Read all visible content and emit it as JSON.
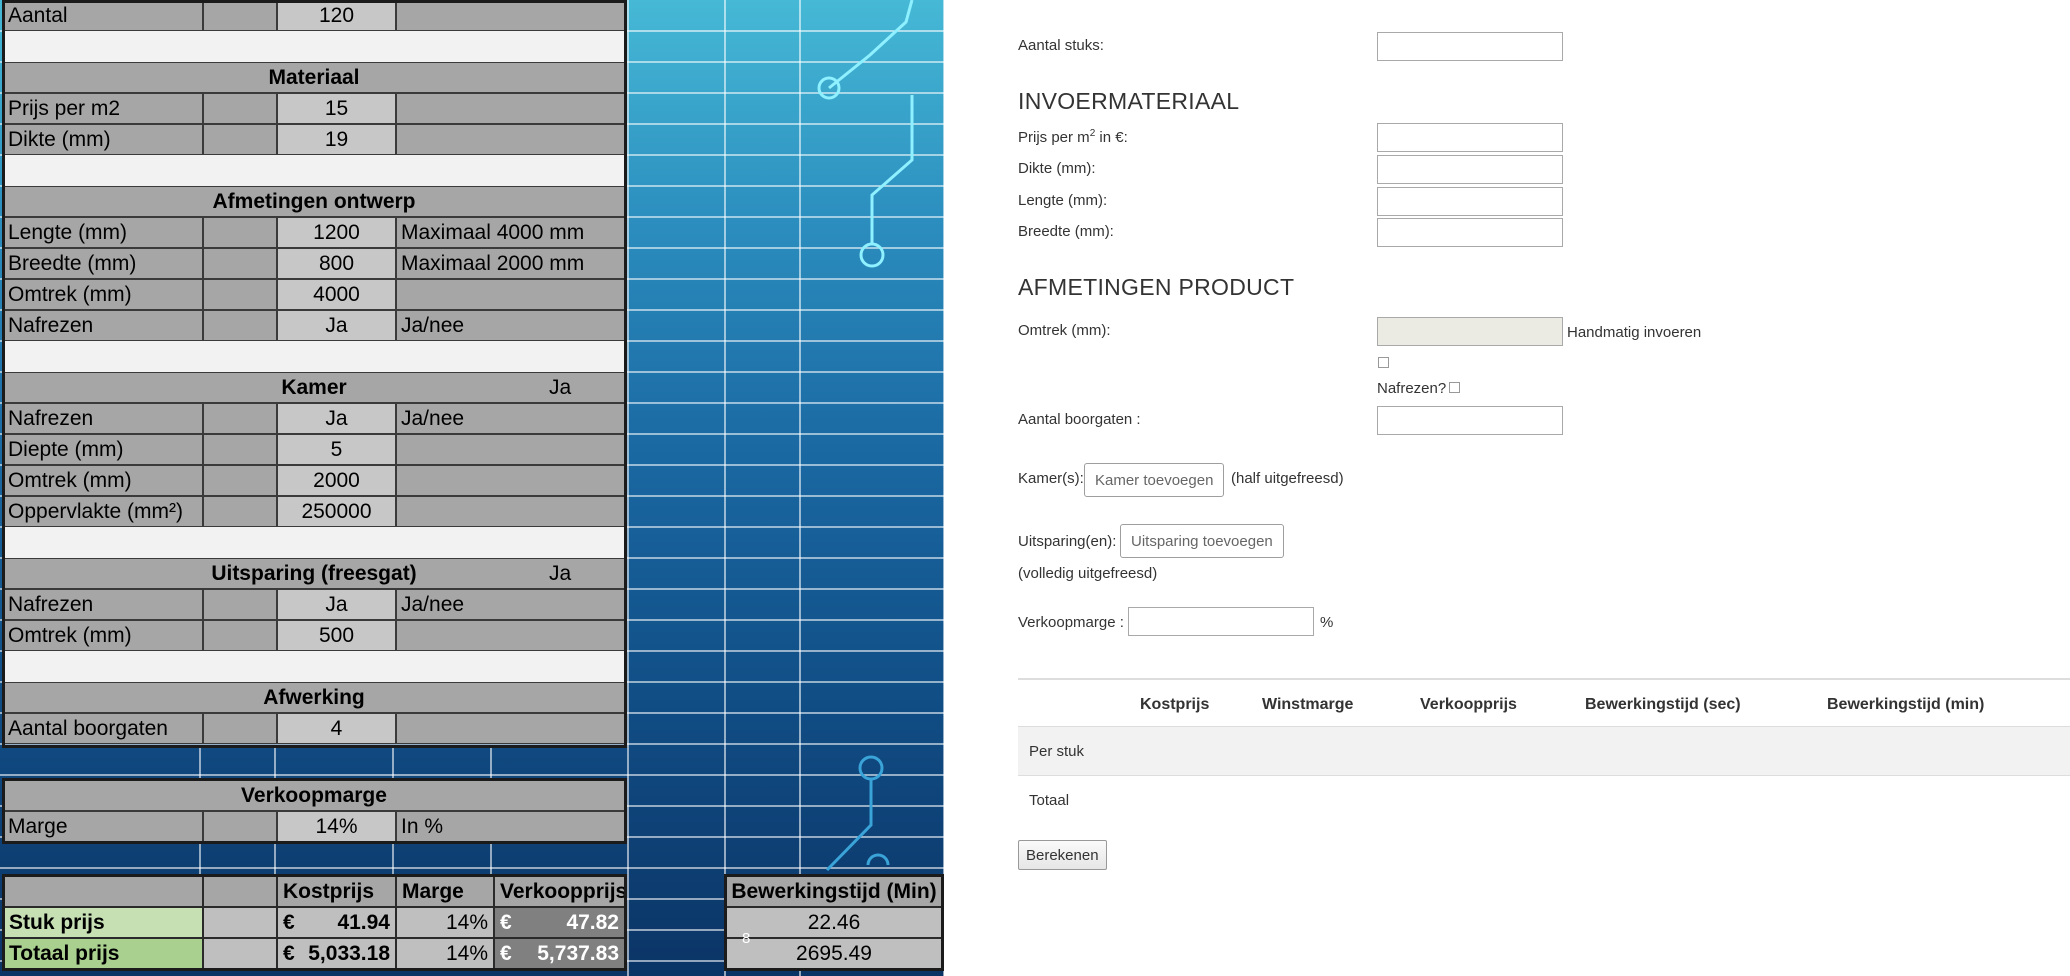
{
  "sheet": {
    "rows": [
      {
        "kind": "data",
        "label": "Aantal",
        "value": "120",
        "note": ""
      },
      {
        "kind": "band"
      },
      {
        "kind": "head",
        "title": "Materiaal",
        "flag": ""
      },
      {
        "kind": "data",
        "label": "Prijs per m2",
        "value": "15",
        "note": ""
      },
      {
        "kind": "data",
        "label": "Dikte (mm)",
        "value": "19",
        "note": ""
      },
      {
        "kind": "band"
      },
      {
        "kind": "head",
        "title": "Afmetingen ontwerp",
        "flag": ""
      },
      {
        "kind": "data",
        "label": "Lengte (mm)",
        "value": "1200",
        "note": "Maximaal 4000 mm"
      },
      {
        "kind": "data",
        "label": "Breedte (mm)",
        "value": "800",
        "note": "Maximaal 2000 mm"
      },
      {
        "kind": "data",
        "label": "Omtrek (mm)",
        "value": "4000",
        "note": ""
      },
      {
        "kind": "data",
        "label": "Nafrezen",
        "value": "Ja",
        "note": "Ja/nee"
      },
      {
        "kind": "band"
      },
      {
        "kind": "head",
        "title": "Kamer",
        "flag": "Ja"
      },
      {
        "kind": "data",
        "label": "Nafrezen",
        "value": "Ja",
        "note": "Ja/nee"
      },
      {
        "kind": "data",
        "label": "Diepte (mm)",
        "value": "5",
        "note": ""
      },
      {
        "kind": "data",
        "label": "Omtrek (mm)",
        "value": "2000",
        "note": ""
      },
      {
        "kind": "data",
        "label": "Oppervlakte (mm²)",
        "value": "250000",
        "note": ""
      },
      {
        "kind": "band"
      },
      {
        "kind": "head",
        "title": "Uitsparing (freesgat)",
        "flag": "Ja"
      },
      {
        "kind": "data",
        "label": "Nafrezen",
        "value": "Ja",
        "note": "Ja/nee"
      },
      {
        "kind": "data",
        "label": "Omtrek (mm)",
        "value": "500",
        "note": ""
      },
      {
        "kind": "band"
      },
      {
        "kind": "head",
        "title": "Afwerking",
        "flag": ""
      },
      {
        "kind": "data",
        "label": "Aantal boorgaten",
        "value": "4",
        "note": ""
      }
    ],
    "marge_head": "Verkoopmarge",
    "marge_row": {
      "label": "Marge",
      "value": "14%",
      "note": "In %"
    },
    "totals": {
      "headers": [
        "Kostprijs",
        "Marge",
        "Verkoopprijs"
      ],
      "rows": [
        {
          "label": "Stuk prijs",
          "currency": "€",
          "kostprijs": "41.94",
          "marge": "14%",
          "verkoopprijs": "47.82"
        },
        {
          "label": "Totaal prijs",
          "currency": "€",
          "kostprijs": "5,033.18",
          "marge": "14%",
          "verkoopprijs": "5,737.83"
        }
      ]
    },
    "bewerking": {
      "header": "Bewerkingstijd (Min)",
      "values": [
        "22.46",
        "2695.49"
      ]
    },
    "page_number": "8"
  },
  "form": {
    "aantal_label": "Aantal stuks:",
    "section_material": "INVOERMATERIAAL",
    "prijs_label_a": "Prijs per m",
    "prijs_label_sup": "2",
    "prijs_label_b": " in €:",
    "dikte_label": "Dikte (mm):",
    "lengte_label": "Lengte (mm):",
    "breedte_label": "Breedte (mm):",
    "section_afmetingen": "AFMETINGEN PRODUCT",
    "omtrek_label": "Omtrek (mm):",
    "handmatig_label": "Handmatig invoeren",
    "nafrezen_label": "Nafrezen?",
    "boorgaten_label": "Aantal boorgaten :",
    "kamers_label": "Kamer(s):",
    "kamer_button": "Kamer toevoegen",
    "kamer_note": "(half uitgefreesd)",
    "uitsparing_label": "Uitsparing(en):",
    "uitsparing_button": "Uitsparing toevoegen",
    "uitsparing_note": "(volledig uitgefreesd)",
    "verkoopmarge_label": "Verkoopmarge :",
    "percent_sign": "%",
    "results": {
      "headers": [
        "Kostprijs",
        "Winstmarge",
        "Verkoopprijs",
        "Bewerkingstijd (sec)",
        "Bewerkingstijd (min)"
      ],
      "rows": [
        "Per stuk",
        "Totaal"
      ]
    },
    "calc_button": "Berekenen"
  }
}
